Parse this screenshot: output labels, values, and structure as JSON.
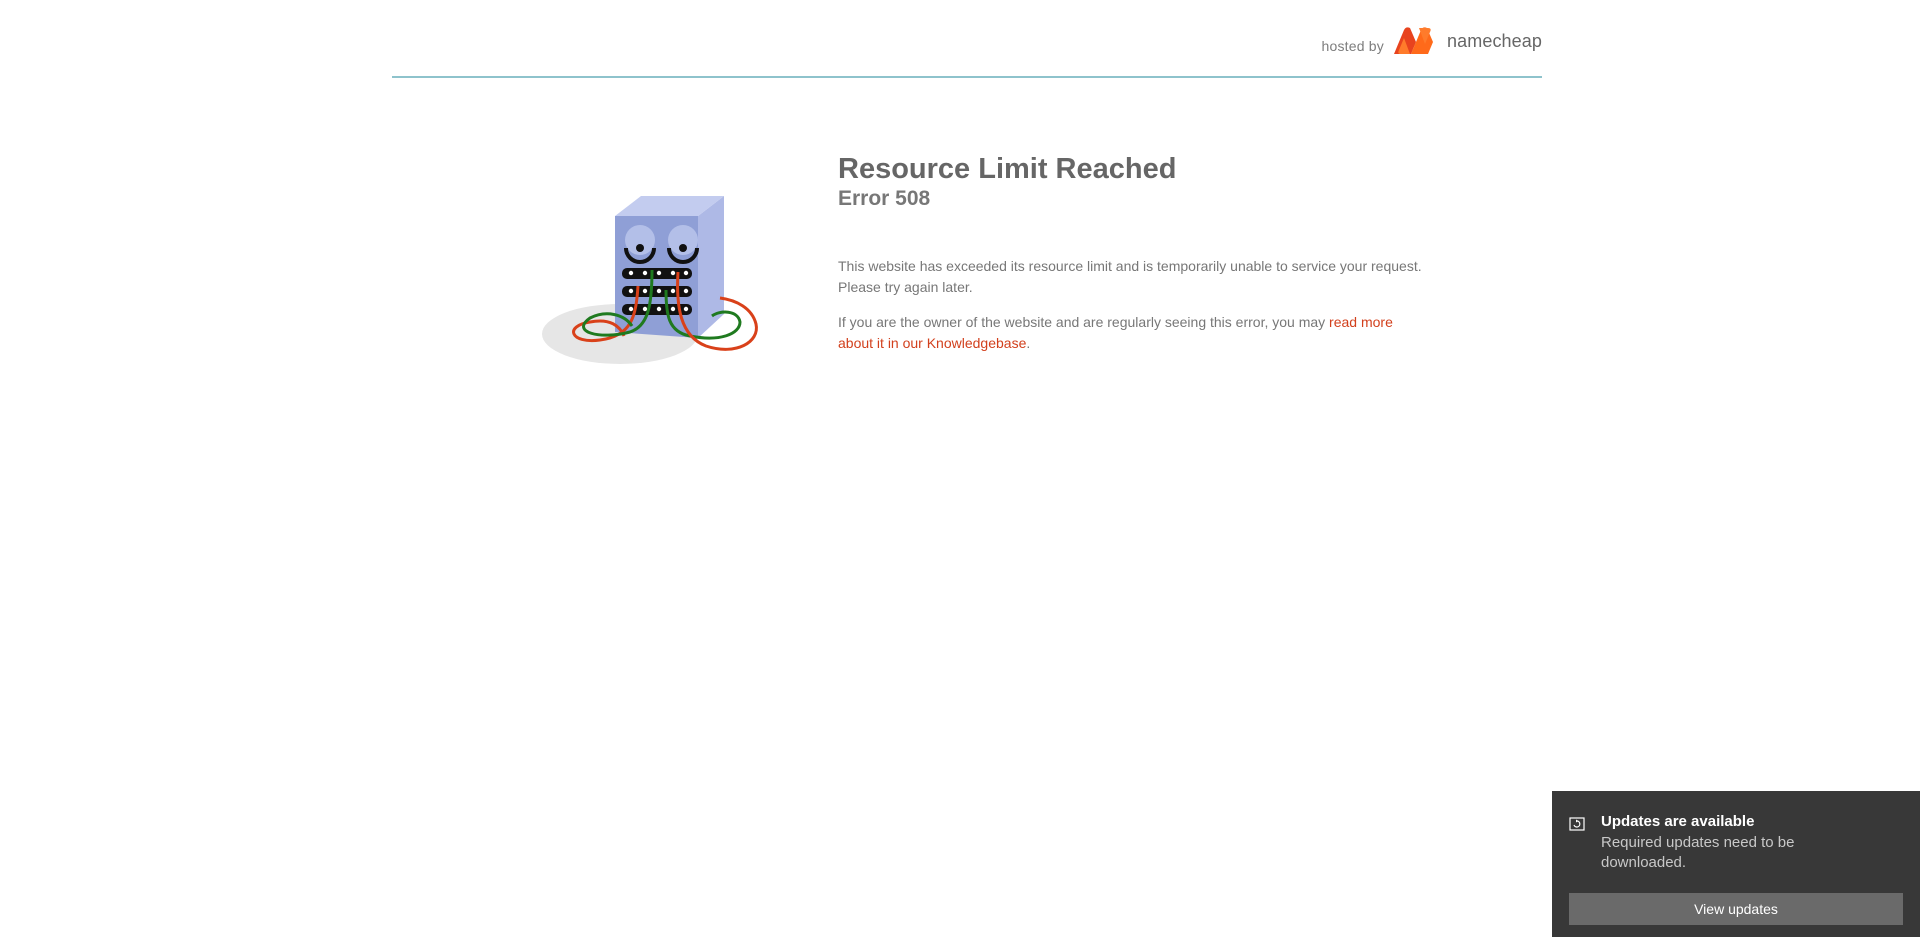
{
  "header": {
    "hosted_by": "hosted by",
    "brand_name": "namecheap",
    "brand_color": "#ff5b1f",
    "divider_color": "#8ec3cc"
  },
  "illustration": {
    "icon": "broken-server-icon"
  },
  "main": {
    "title": "Resource Limit Reached",
    "subtitle": "Error 508",
    "paragraph_1": "This website has exceeded its resource limit and is temporarily unable to service your request. Please try again later.",
    "paragraph_2_prefix": "If you are the owner of the website and are regularly seeing this error, you may ",
    "paragraph_2_link": "read more about it in our Knowledgebase",
    "paragraph_2_suffix": ".",
    "link_color": "#d2401d"
  },
  "toast": {
    "icon": "update-icon",
    "title": "Updates are available",
    "body": "Required updates need to be downloaded.",
    "button_label": "View updates",
    "background_color": "#383838"
  }
}
